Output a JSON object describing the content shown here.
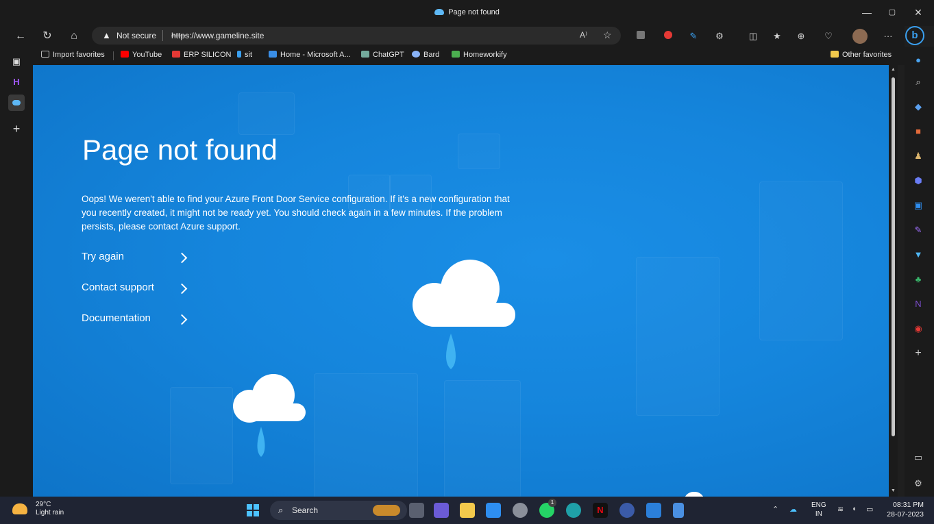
{
  "window": {
    "title": "Page not found",
    "minimize": "—",
    "restore": "▢",
    "close": "✕"
  },
  "navbar": {
    "back": "←",
    "refresh": "↻",
    "home": "⌂",
    "security_icon": "▲",
    "security_label": "Not secure",
    "url_scheme": "https",
    "url_rest": "://www.gameline.site",
    "read_aloud": "A⁾",
    "star": "☆",
    "more": "···",
    "copilot": "b"
  },
  "favorites": {
    "items": [
      {
        "label": "Import favorites",
        "color": "#bdbdbd"
      },
      {
        "label": "YouTube",
        "color": "#ff0000"
      },
      {
        "label": "ERP SILICON",
        "color": "#e53935"
      },
      {
        "label": "sit",
        "color": "#3aa0f0"
      },
      {
        "label": "Home - Microsoft A...",
        "color": "#3a8ee6"
      },
      {
        "label": "ChatGPT",
        "color": "#74aa9c"
      },
      {
        "label": "Bard",
        "color": "#8ab4f8"
      },
      {
        "label": "Homeworkify",
        "color": "#4caf50"
      }
    ],
    "other": "Other favorites"
  },
  "page": {
    "heading": "Page not found",
    "description": "Oops! We weren't able to find your Azure Front Door Service configuration. If it's a new configuration that you recently created, it might not be ready yet. You should check again in a few minutes. If the problem persists, please contact Azure support.",
    "links": [
      {
        "label": "Try again"
      },
      {
        "label": "Contact support"
      },
      {
        "label": "Documentation"
      }
    ]
  },
  "sidebar_add": "+",
  "vtabs_add": "+",
  "taskbar": {
    "temperature": "29°C",
    "condition": "Light rain",
    "search_label": "Search",
    "lang": "ENG",
    "region": "IN",
    "time": "08:31 PM",
    "date": "28-07-2023",
    "whatsapp_badge": "1"
  },
  "colors": {
    "page_bg": "#1585dc",
    "chrome": "#1b1b1b",
    "taskbar": "#1f2433"
  }
}
